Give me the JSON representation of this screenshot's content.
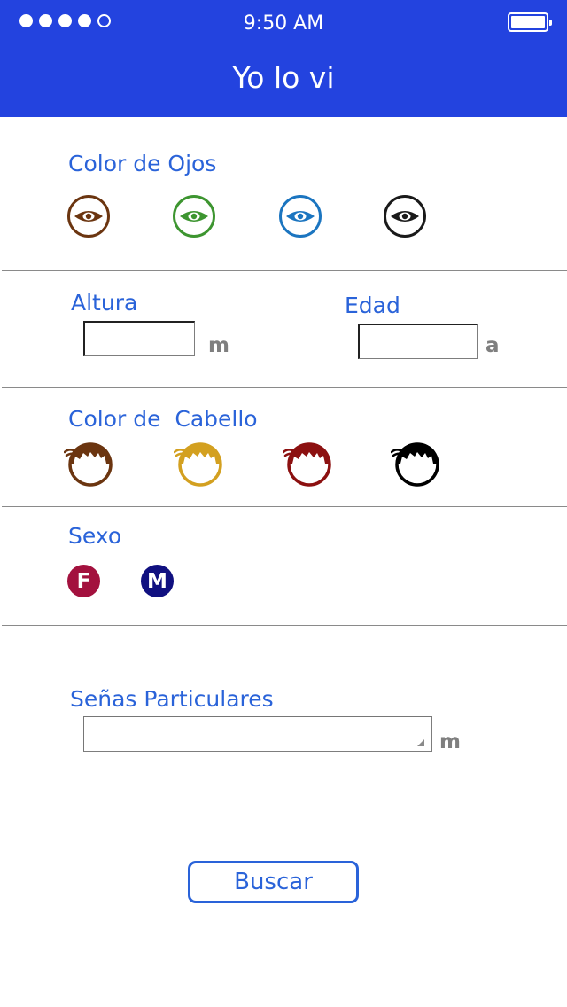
{
  "status_bar": {
    "time": "9:50 AM",
    "signal_dots": 5,
    "signal_filled": 4
  },
  "header": {
    "title": "Yo lo vi",
    "background": "#2343df"
  },
  "eye_color": {
    "label": "Color de Ojos",
    "options": [
      {
        "name": "brown",
        "color": "#6b3510",
        "icon": "eye-icon"
      },
      {
        "name": "green",
        "color": "#3d9530",
        "icon": "eye-icon"
      },
      {
        "name": "blue",
        "color": "#1b75c0",
        "icon": "eye-icon"
      },
      {
        "name": "black",
        "color": "#1a1a1a",
        "icon": "eye-icon"
      }
    ]
  },
  "height": {
    "label": "Altura",
    "value": "",
    "unit": "m"
  },
  "age": {
    "label": "Edad",
    "value": "",
    "unit": "a"
  },
  "hair_color": {
    "label": "Color de  Cabello",
    "options": [
      {
        "name": "brown",
        "color": "#6b3510",
        "icon": "hair-icon"
      },
      {
        "name": "blonde",
        "color": "#d3a020",
        "icon": "hair-icon"
      },
      {
        "name": "red",
        "color": "#8c1010",
        "icon": "hair-icon"
      },
      {
        "name": "black",
        "color": "#000000",
        "icon": "hair-icon"
      }
    ]
  },
  "sex": {
    "label": "Sexo",
    "options": [
      {
        "letter": "F",
        "color": "#a3113e"
      },
      {
        "letter": "M",
        "color": "#101080"
      }
    ]
  },
  "distinguishing_marks": {
    "label": "Señas Particulares",
    "value": "",
    "unit": "m"
  },
  "search_button": {
    "label": "Buscar"
  },
  "accent_color": "#2a63d9"
}
